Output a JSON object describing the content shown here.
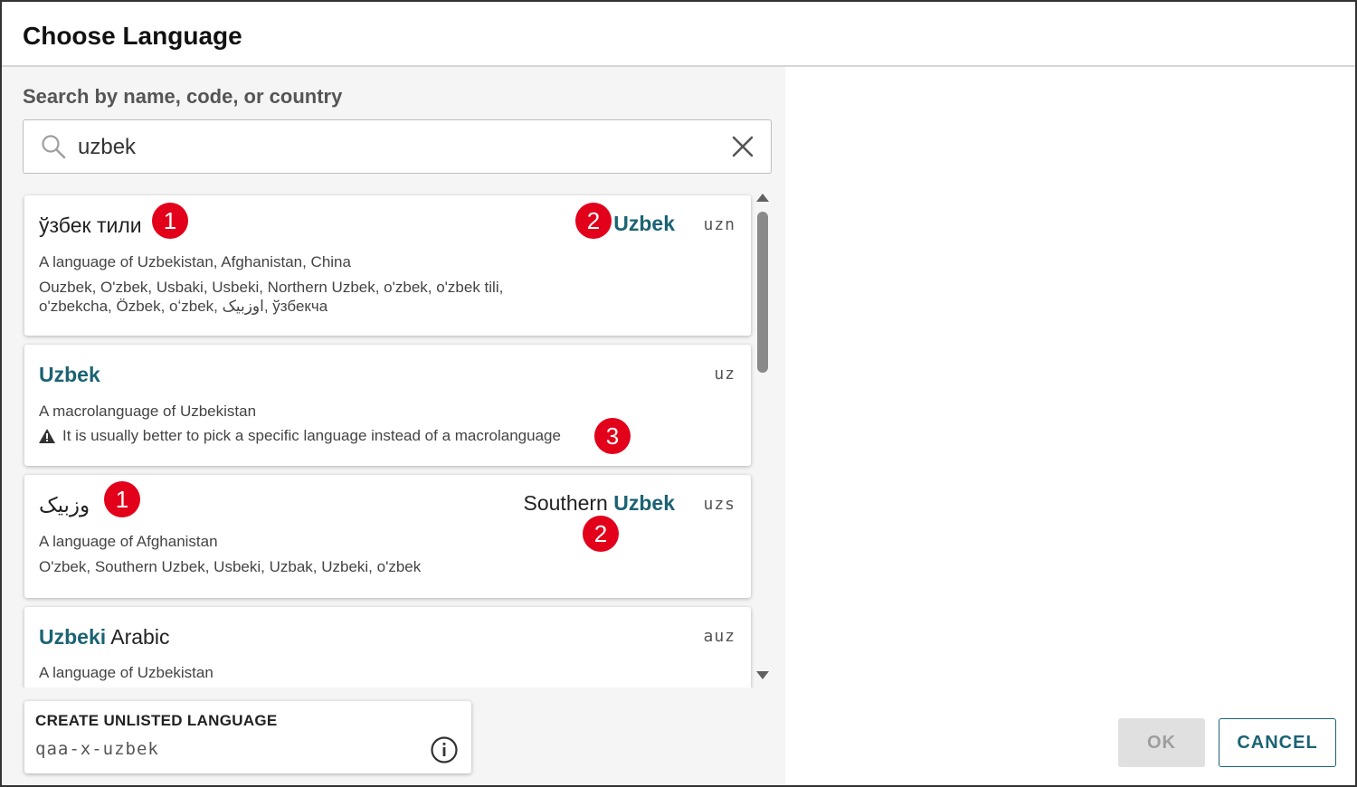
{
  "dialog": {
    "title": "Choose Language"
  },
  "search": {
    "label": "Search by name, code, or country",
    "value": "uzbek"
  },
  "results": [
    {
      "native_name": "ўзбек тили",
      "english_name_prefix": "",
      "english_name_match": "Uzbek",
      "english_name_suffix": "",
      "code": "uzn",
      "description": "A language of Uzbekistan, Afghanistan, China",
      "alt_names": "Ouzbek, O'zbek, Usbaki, Usbeki, Northern Uzbek, o'zbek, o'zbek tili, o'zbekcha, Özbek, oʻzbek, اوزبیک, ўзбекча"
    },
    {
      "native_name_match": "Uzbek",
      "code": "uz",
      "description": "A macrolanguage of Uzbekistan",
      "warning": "It is usually better to pick a specific language instead of a macrolanguage"
    },
    {
      "native_name": "وزبیک",
      "english_name_prefix": "Southern ",
      "english_name_match": "Uzbek",
      "code": "uzs",
      "description": "A language of Afghanistan",
      "alt_names": "O'zbek, Southern Uzbek, Usbeki, Uzbak, Uzbeki, o'zbek"
    },
    {
      "native_name_match": "Uzbeki",
      "native_name_suffix": " Arabic",
      "code": "auz",
      "description": "A language of Uzbekistan"
    }
  ],
  "annotations": [
    "1",
    "2",
    "3",
    "1",
    "2"
  ],
  "unlisted": {
    "label": "CREATE UNLISTED LANGUAGE",
    "code": "qaa-x-uzbek"
  },
  "buttons": {
    "ok": "OK",
    "cancel": "CANCEL"
  },
  "colors": {
    "accent": "#1b6373",
    "badge": "#e2001a"
  }
}
